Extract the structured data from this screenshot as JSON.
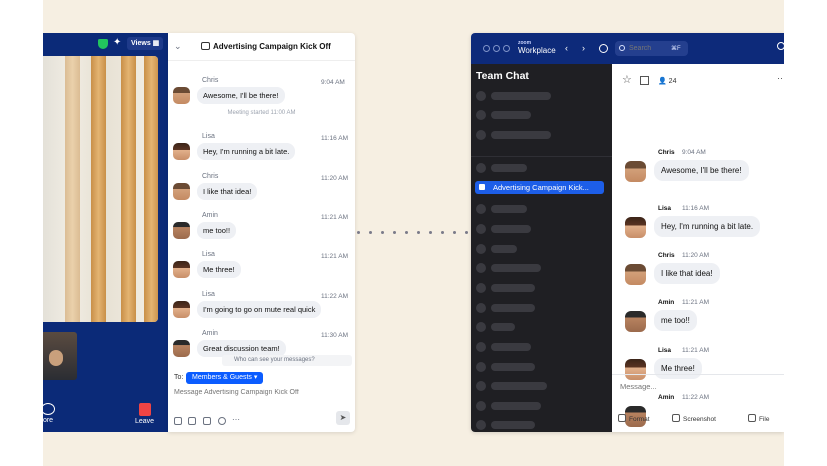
{
  "meeting": {
    "views_label": "Views",
    "more_label": "ore",
    "leave_label": "Leave"
  },
  "chat_panel": {
    "title": "Advertising Campaign Kick Off",
    "meeting_started": "Meeting started 11:00 AM",
    "messages": [
      {
        "sender": "Chris",
        "time": "9:04 AM",
        "text": "Awesome, I'll be there!"
      },
      {
        "sender": "Lisa",
        "time": "11:16 AM",
        "text": "Hey, I'm running a bit late."
      },
      {
        "sender": "Chris",
        "time": "11:20 AM",
        "text": "I like that idea!"
      },
      {
        "sender": "Amin",
        "time": "11:21 AM",
        "text": "me too!!"
      },
      {
        "sender": "Lisa",
        "time": "11:21 AM",
        "text": "Me three!"
      },
      {
        "sender": "Lisa",
        "time": "11:22 AM",
        "text": "I'm going to go on mute real quick"
      },
      {
        "sender": "Amin",
        "time": "11:30 AM",
        "text": "Great discussion team!"
      }
    ],
    "who_can_see": "Who can see your messages?",
    "to_label": "To:",
    "recipient": "Members & Guests ▾",
    "input_placeholder": "Message Advertising Campaign Kick Off"
  },
  "workplace": {
    "brand_small": "zoom",
    "brand": "Workplace",
    "search_placeholder": "Search",
    "search_shortcut": "⌘F",
    "sidebar_title": "Team Chat",
    "active_channel": "Advertising Campaign Kick...",
    "member_count": "24",
    "messages": [
      {
        "sender": "Chris",
        "time": "9:04 AM",
        "text": "Awesome, I'll be there!"
      },
      {
        "sender": "Lisa",
        "time": "11:16 AM",
        "text": "Hey, I'm running a bit late."
      },
      {
        "sender": "Chris",
        "time": "11:20 AM",
        "text": "I like that idea!"
      },
      {
        "sender": "Amin",
        "time": "11:21 AM",
        "text": "me too!!"
      },
      {
        "sender": "Lisa",
        "time": "11:21 AM",
        "text": "Me three!"
      },
      {
        "sender": "Amin",
        "time": "11:22 AM",
        "text": ""
      }
    ],
    "input_placeholder": "Message...",
    "tools": {
      "format": "Format",
      "screenshot": "Screenshot",
      "file": "File"
    }
  }
}
